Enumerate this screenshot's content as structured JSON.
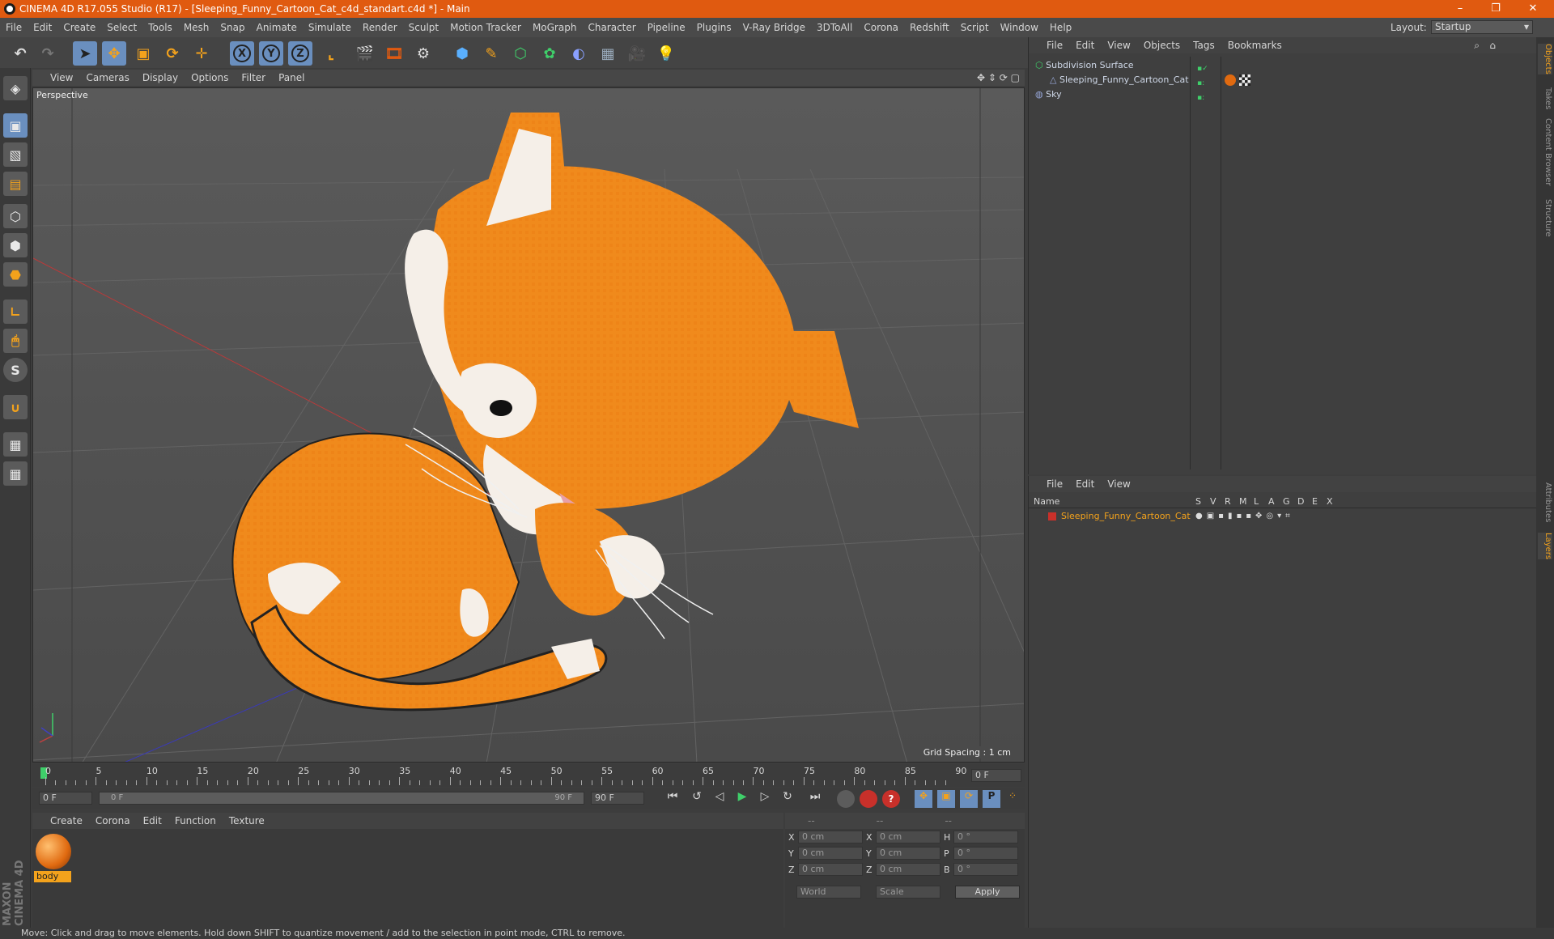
{
  "window": {
    "title": "CINEMA 4D R17.055 Studio (R17) - [Sleeping_Funny_Cartoon_Cat_c4d_standart.c4d *] - Main",
    "minimize": "–",
    "restore": "❐",
    "close": "✕"
  },
  "menubar": {
    "items": [
      "File",
      "Edit",
      "Create",
      "Select",
      "Tools",
      "Mesh",
      "Snap",
      "Animate",
      "Simulate",
      "Render",
      "Sculpt",
      "Motion Tracker",
      "MoGraph",
      "Character",
      "Pipeline",
      "Plugins",
      "V-Ray Bridge",
      "3DToAll",
      "Corona",
      "Redshift",
      "Script",
      "Window",
      "Help"
    ],
    "layout_label": "Layout:",
    "layout_value": "Startup"
  },
  "toolbar": {
    "axis_x": "X",
    "axis_y": "Y",
    "axis_z": "Z"
  },
  "viewport": {
    "menu": [
      "View",
      "Cameras",
      "Display",
      "Options",
      "Filter",
      "Panel"
    ],
    "label": "Perspective",
    "grid_spacing": "Grid Spacing : 1 cm"
  },
  "timeline": {
    "ticks": [
      "0",
      "5",
      "10",
      "15",
      "20",
      "25",
      "30",
      "35",
      "40",
      "45",
      "50",
      "55",
      "60",
      "65",
      "70",
      "75",
      "80",
      "85",
      "90"
    ],
    "current_frame": "0 F",
    "start_field": "0 F",
    "range_start": "0 F",
    "range_end": "90 F",
    "end_field": "90 F"
  },
  "material_panel": {
    "menu": [
      "Create",
      "Corona",
      "Edit",
      "Function",
      "Texture"
    ],
    "material_name": "body"
  },
  "coord_panel": {
    "header": [
      "--",
      "--",
      "--"
    ],
    "rows": [
      {
        "a": "X",
        "av": "0 cm",
        "b": "X",
        "bv": "0 cm",
        "c": "H",
        "cv": "0 °"
      },
      {
        "a": "Y",
        "av": "0 cm",
        "b": "Y",
        "bv": "0 cm",
        "c": "P",
        "cv": "0 °"
      },
      {
        "a": "Z",
        "av": "0 cm",
        "b": "Z",
        "bv": "0 cm",
        "c": "B",
        "cv": "0 °"
      }
    ],
    "world": "World",
    "scale": "Scale",
    "apply": "Apply"
  },
  "object_manager": {
    "menu": [
      "File",
      "Edit",
      "View",
      "Objects",
      "Tags",
      "Bookmarks"
    ],
    "objects": [
      "Subdivision Surface",
      "Sleeping_Funny_Cartoon_Cat",
      "Sky"
    ]
  },
  "layer_manager": {
    "menu": [
      "File",
      "Edit",
      "View"
    ],
    "col_name": "Name",
    "cols": [
      "S",
      "V",
      "R",
      "M",
      "L",
      "A",
      "G",
      "D",
      "E",
      "X"
    ],
    "layer": "Sleeping_Funny_Cartoon_Cat"
  },
  "side_tabs": [
    "Objects",
    "Takes",
    "Content Browser",
    "Structure",
    "Attributes",
    "Layers"
  ],
  "status": "Move: Click and drag to move elements. Hold down SHIFT to quantize movement / add to the selection in point mode, CTRL to remove.",
  "brand": "MAXON CINEMA 4D",
  "colors": {
    "accent": "#e05a10",
    "cat_orange": "#f08a1c",
    "active_blue": "#6a8fbf"
  }
}
